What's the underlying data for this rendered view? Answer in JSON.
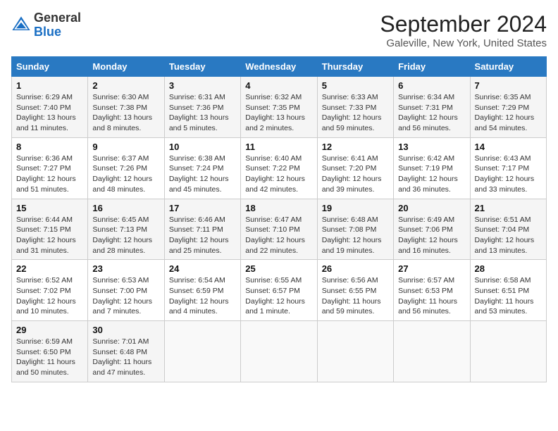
{
  "header": {
    "logo_general": "General",
    "logo_blue": "Blue",
    "month_title": "September 2024",
    "location": "Galeville, New York, United States"
  },
  "days_of_week": [
    "Sunday",
    "Monday",
    "Tuesday",
    "Wednesday",
    "Thursday",
    "Friday",
    "Saturday"
  ],
  "weeks": [
    [
      {
        "day": "1",
        "sunrise": "6:29 AM",
        "sunset": "7:40 PM",
        "daylight": "13 hours and 11 minutes."
      },
      {
        "day": "2",
        "sunrise": "6:30 AM",
        "sunset": "7:38 PM",
        "daylight": "13 hours and 8 minutes."
      },
      {
        "day": "3",
        "sunrise": "6:31 AM",
        "sunset": "7:36 PM",
        "daylight": "13 hours and 5 minutes."
      },
      {
        "day": "4",
        "sunrise": "6:32 AM",
        "sunset": "7:35 PM",
        "daylight": "13 hours and 2 minutes."
      },
      {
        "day": "5",
        "sunrise": "6:33 AM",
        "sunset": "7:33 PM",
        "daylight": "12 hours and 59 minutes."
      },
      {
        "day": "6",
        "sunrise": "6:34 AM",
        "sunset": "7:31 PM",
        "daylight": "12 hours and 56 minutes."
      },
      {
        "day": "7",
        "sunrise": "6:35 AM",
        "sunset": "7:29 PM",
        "daylight": "12 hours and 54 minutes."
      }
    ],
    [
      {
        "day": "8",
        "sunrise": "6:36 AM",
        "sunset": "7:27 PM",
        "daylight": "12 hours and 51 minutes."
      },
      {
        "day": "9",
        "sunrise": "6:37 AM",
        "sunset": "7:26 PM",
        "daylight": "12 hours and 48 minutes."
      },
      {
        "day": "10",
        "sunrise": "6:38 AM",
        "sunset": "7:24 PM",
        "daylight": "12 hours and 45 minutes."
      },
      {
        "day": "11",
        "sunrise": "6:40 AM",
        "sunset": "7:22 PM",
        "daylight": "12 hours and 42 minutes."
      },
      {
        "day": "12",
        "sunrise": "6:41 AM",
        "sunset": "7:20 PM",
        "daylight": "12 hours and 39 minutes."
      },
      {
        "day": "13",
        "sunrise": "6:42 AM",
        "sunset": "7:19 PM",
        "daylight": "12 hours and 36 minutes."
      },
      {
        "day": "14",
        "sunrise": "6:43 AM",
        "sunset": "7:17 PM",
        "daylight": "12 hours and 33 minutes."
      }
    ],
    [
      {
        "day": "15",
        "sunrise": "6:44 AM",
        "sunset": "7:15 PM",
        "daylight": "12 hours and 31 minutes."
      },
      {
        "day": "16",
        "sunrise": "6:45 AM",
        "sunset": "7:13 PM",
        "daylight": "12 hours and 28 minutes."
      },
      {
        "day": "17",
        "sunrise": "6:46 AM",
        "sunset": "7:11 PM",
        "daylight": "12 hours and 25 minutes."
      },
      {
        "day": "18",
        "sunrise": "6:47 AM",
        "sunset": "7:10 PM",
        "daylight": "12 hours and 22 minutes."
      },
      {
        "day": "19",
        "sunrise": "6:48 AM",
        "sunset": "7:08 PM",
        "daylight": "12 hours and 19 minutes."
      },
      {
        "day": "20",
        "sunrise": "6:49 AM",
        "sunset": "7:06 PM",
        "daylight": "12 hours and 16 minutes."
      },
      {
        "day": "21",
        "sunrise": "6:51 AM",
        "sunset": "7:04 PM",
        "daylight": "12 hours and 13 minutes."
      }
    ],
    [
      {
        "day": "22",
        "sunrise": "6:52 AM",
        "sunset": "7:02 PM",
        "daylight": "12 hours and 10 minutes."
      },
      {
        "day": "23",
        "sunrise": "6:53 AM",
        "sunset": "7:00 PM",
        "daylight": "12 hours and 7 minutes."
      },
      {
        "day": "24",
        "sunrise": "6:54 AM",
        "sunset": "6:59 PM",
        "daylight": "12 hours and 4 minutes."
      },
      {
        "day": "25",
        "sunrise": "6:55 AM",
        "sunset": "6:57 PM",
        "daylight": "12 hours and 1 minute."
      },
      {
        "day": "26",
        "sunrise": "6:56 AM",
        "sunset": "6:55 PM",
        "daylight": "11 hours and 59 minutes."
      },
      {
        "day": "27",
        "sunrise": "6:57 AM",
        "sunset": "6:53 PM",
        "daylight": "11 hours and 56 minutes."
      },
      {
        "day": "28",
        "sunrise": "6:58 AM",
        "sunset": "6:51 PM",
        "daylight": "11 hours and 53 minutes."
      }
    ],
    [
      {
        "day": "29",
        "sunrise": "6:59 AM",
        "sunset": "6:50 PM",
        "daylight": "11 hours and 50 minutes."
      },
      {
        "day": "30",
        "sunrise": "7:01 AM",
        "sunset": "6:48 PM",
        "daylight": "11 hours and 47 minutes."
      },
      null,
      null,
      null,
      null,
      null
    ]
  ]
}
